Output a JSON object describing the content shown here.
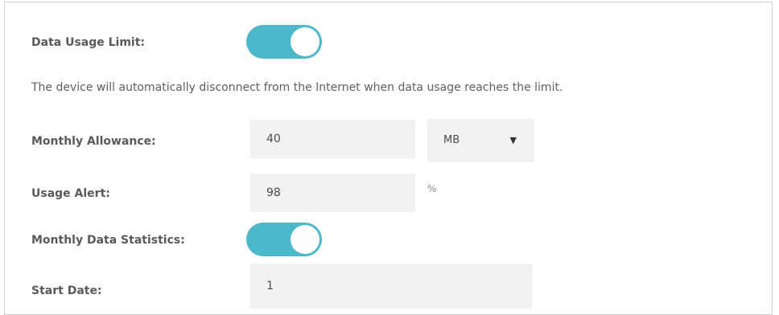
{
  "data_usage_limit": {
    "label": "Data Usage Limit:",
    "enabled": true,
    "description": "The device will automatically disconnect from the Internet when data usage reaches the limit."
  },
  "monthly_allowance": {
    "label": "Monthly Allowance:",
    "value": "40",
    "unit_selected": "MB"
  },
  "usage_alert": {
    "label": "Usage Alert:",
    "value": "98",
    "unit": "%"
  },
  "monthly_data_statistics": {
    "label": "Monthly Data Statistics:",
    "enabled": true
  },
  "start_date": {
    "label": "Start Date:",
    "value": "1"
  },
  "colors": {
    "toggle_on": "#4db8c9",
    "field_bg": "#f2f2f2"
  }
}
